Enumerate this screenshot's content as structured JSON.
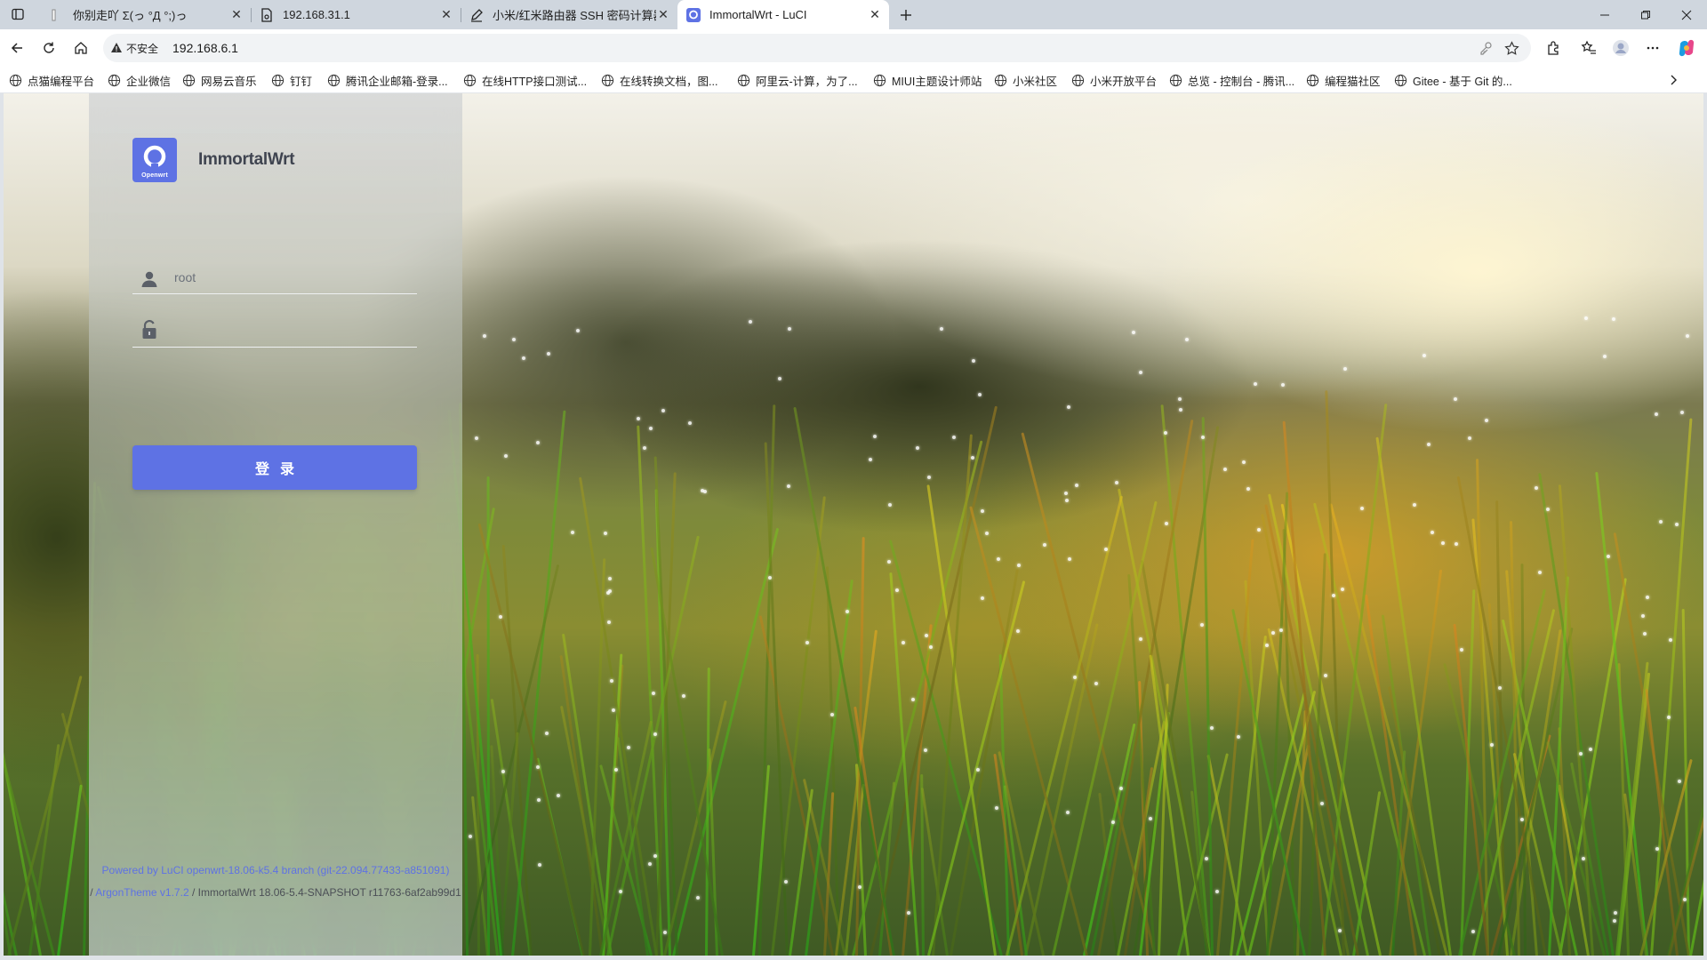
{
  "browser": {
    "tabs": [
      {
        "title": "你别走吖 Σ(っ °Д °;)っ",
        "active": false,
        "icon": "page-icon"
      },
      {
        "title": "192.168.31.1",
        "active": false,
        "icon": "doc-icon"
      },
      {
        "title": "小米/红米路由器 SSH 密码计算器",
        "active": false,
        "icon": "pen-icon"
      },
      {
        "title": "ImmortalWrt - LuCI",
        "active": true,
        "icon": "openwrt-icon"
      }
    ],
    "security_label": "不安全",
    "url": "192.168.6.1",
    "bookmarks": [
      "点猫编程平台",
      "企业微信",
      "网易云音乐",
      "钉钉",
      "腾讯企业邮箱-登录...",
      "在线HTTP接口测试...",
      "在线转换文档，图...",
      "阿里云-计算，为了...",
      "MIUI主题设计师站",
      "小米社区",
      "小米开放平台",
      "总览 - 控制台 - 腾讯...",
      "编程猫社区",
      "Gitee - 基于 Git 的..."
    ]
  },
  "login": {
    "logo_text": "Openwrt",
    "brand_name": "ImmortalWrt",
    "username_placeholder": "root",
    "password_placeholder": "",
    "button_label": "登录"
  },
  "footer": {
    "powered_by": "Powered by LuCI openwrt-18.06-k5.4 branch (git-22.094.77433-a851091)",
    "separator": " / ",
    "theme": "ArgonTheme v1.7.2",
    "version_text": " / ImmortalWrt 18.06-5.4-SNAPSHOT r11763-6af2ab99d1"
  },
  "colors": {
    "accent": "#5e72e4",
    "tabstrip": "#cfd6de"
  }
}
